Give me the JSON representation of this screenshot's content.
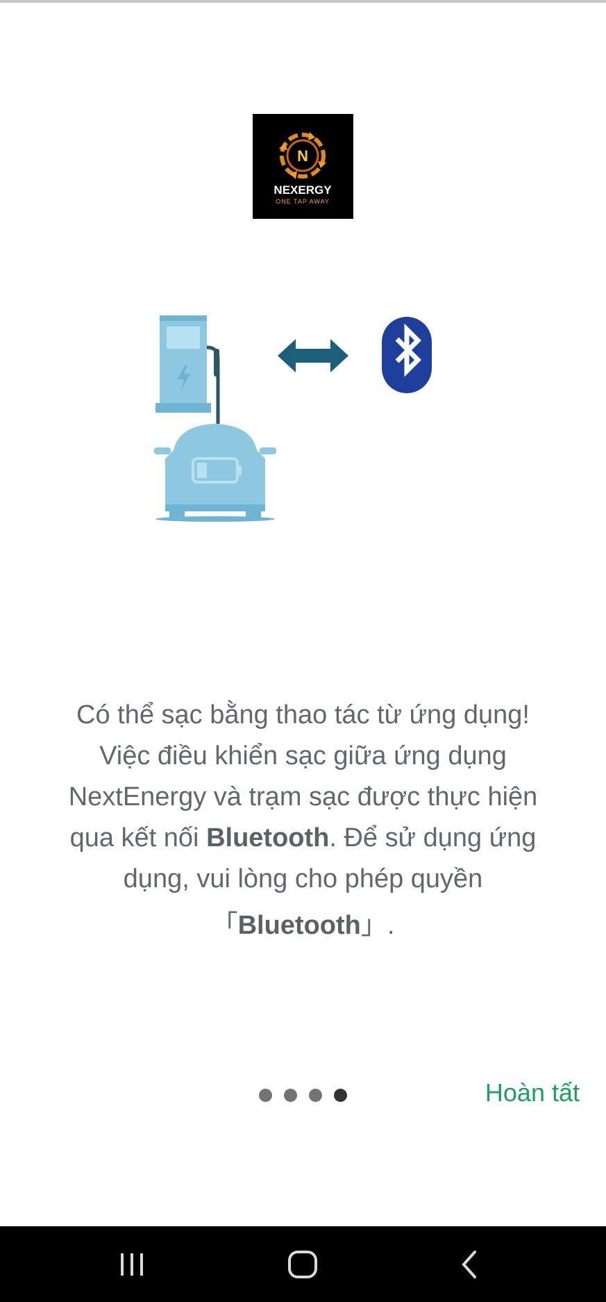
{
  "logo": {
    "brand": "NEXERGY",
    "tagline": "ONE TAP AWAY",
    "monogram": "N"
  },
  "illustration": {
    "icons": [
      "ev-charger-icon",
      "car-battery-icon",
      "double-arrow-icon",
      "bluetooth-icon"
    ],
    "colors": {
      "charger": "#8dc8e0",
      "arrow": "#1d5f7a",
      "bluetooth": "#1e3f9c"
    }
  },
  "description": {
    "line1": "Có thể sạc bằng thao tác từ ứng dụng!",
    "line2": "Việc điều khiển sạc giữa ứng dụng",
    "line3": "NextEnergy và trạm sạc được thực hiện",
    "line4_pre": "qua kết nối ",
    "line4_bold": "Bluetooth",
    "line4_post": ". Để sử dụng ứng",
    "line5": "dụng, vui lòng cho phép quyền",
    "line6_open": "「",
    "line6_bold": "Bluetooth",
    "line6_close": "」.",
    "text_color": "#63676b"
  },
  "pager": {
    "total": 4,
    "current": 4
  },
  "actions": {
    "done_label": "Hoàn tất",
    "done_color": "#1e9e62"
  },
  "navbar": {
    "icons": [
      "recent-apps-icon",
      "home-icon",
      "back-icon"
    ]
  }
}
